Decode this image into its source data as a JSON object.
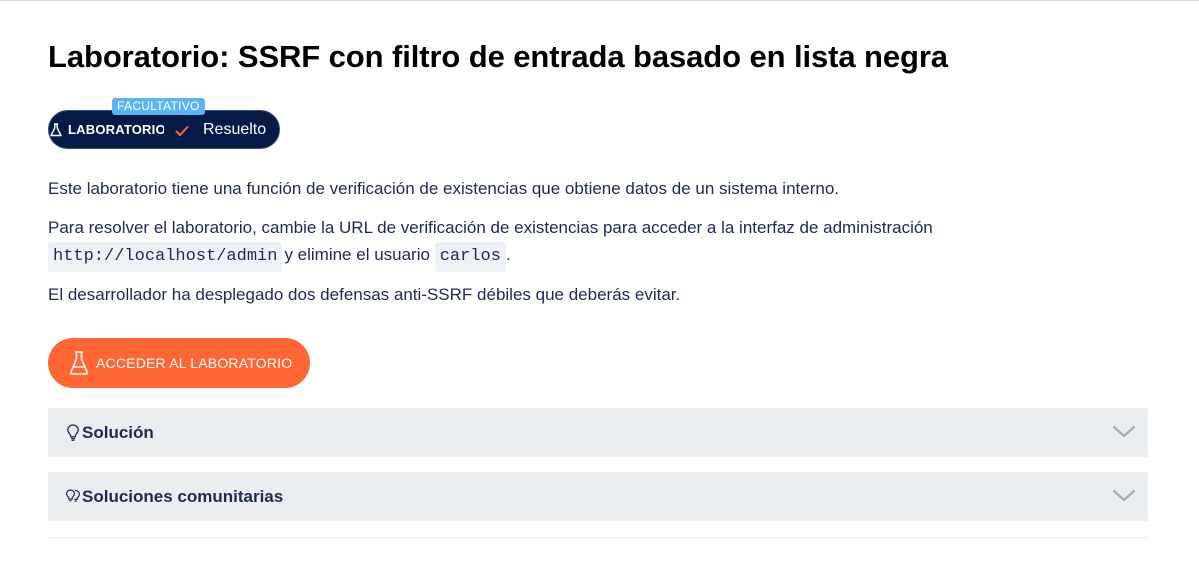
{
  "page": {
    "title": "Laboratorio: SSRF con filtro de entrada basado en lista negra"
  },
  "badge": {
    "optional_label": "FACULTATIVO",
    "lab_label": "LABORATORIO",
    "status_label": "Resuelto"
  },
  "description": {
    "p1": "Este laboratorio tiene una función de verificación de existencias que obtiene datos de un sistema interno.",
    "p2_start": "Para resolver el laboratorio, cambie la URL de verificación de existencias para acceder a la interfaz de administración",
    "p2_code1": "http://localhost/admin",
    "p2_middle": "y elimine el usuario",
    "p2_code2": "carlos",
    "p2_end": ".",
    "p3": "El desarrollador ha desplegado dos defensas anti-SSRF débiles que deberás evitar."
  },
  "access_button": {
    "label": "ACCEDER AL LABORATORIO",
    "icon": "flask-icon"
  },
  "accordions": [
    {
      "label": "Solución",
      "icon": "lightbulb-icon"
    },
    {
      "label": "Soluciones comunitarias",
      "icon": "double-lightbulb-icon"
    }
  ],
  "colors": {
    "badge_bg": "#061a48",
    "optional_badge": "#5ab5f0",
    "access_button": "#ff6633",
    "accordion_bg": "#ebeef1",
    "text": "#1f2a4d"
  }
}
